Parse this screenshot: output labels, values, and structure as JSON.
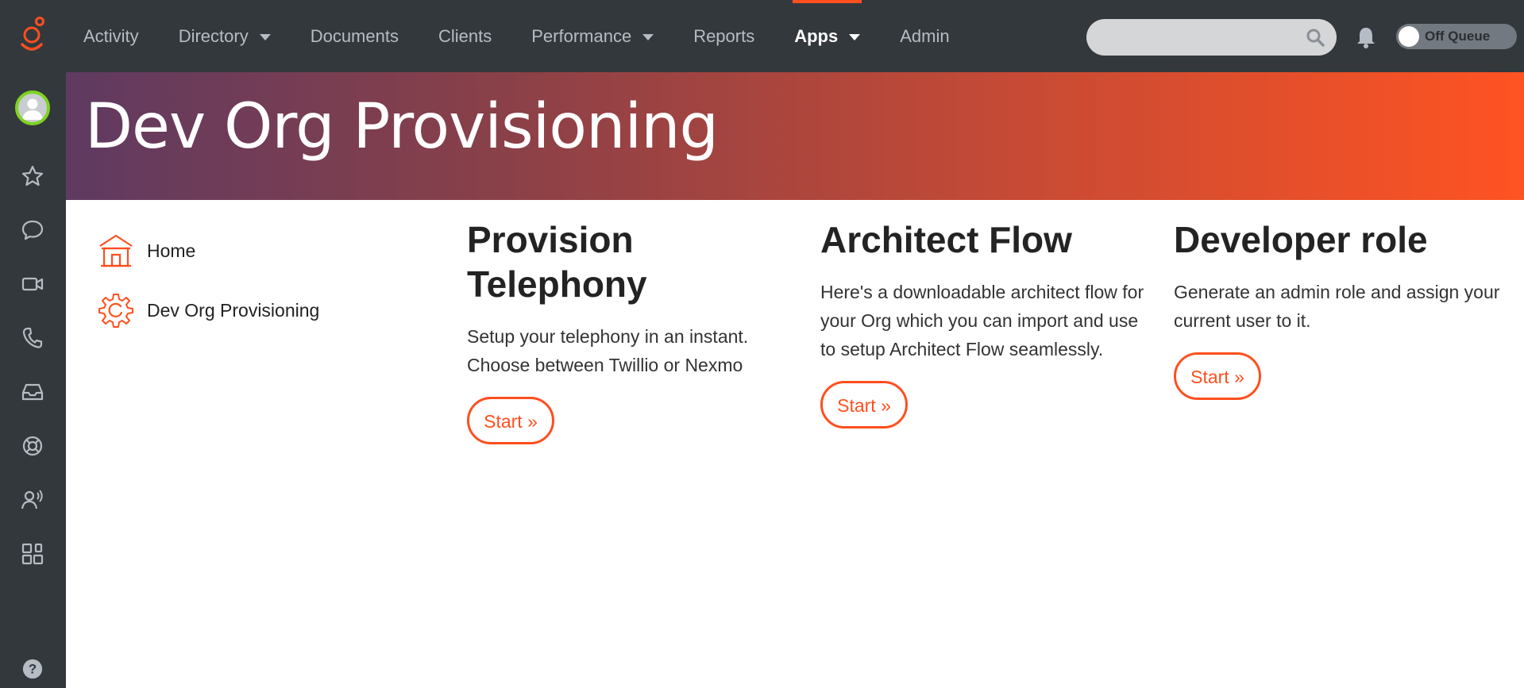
{
  "nav": {
    "items": [
      {
        "label": "Activity",
        "dropdown": false,
        "active": false
      },
      {
        "label": "Directory",
        "dropdown": true,
        "active": false
      },
      {
        "label": "Documents",
        "dropdown": false,
        "active": false
      },
      {
        "label": "Clients",
        "dropdown": false,
        "active": false
      },
      {
        "label": "Performance",
        "dropdown": true,
        "active": false
      },
      {
        "label": "Reports",
        "dropdown": false,
        "active": false
      },
      {
        "label": "Apps",
        "dropdown": true,
        "active": true
      },
      {
        "label": "Admin",
        "dropdown": false,
        "active": false
      }
    ],
    "search_placeholder": "",
    "queue_status": "Off Queue"
  },
  "rail": {
    "icons": [
      "favorites-icon",
      "chat-icon",
      "video-icon",
      "phone-icon",
      "inbox-icon",
      "support-icon",
      "voice-user-icon",
      "apps-grid-icon",
      "help-icon"
    ]
  },
  "page": {
    "title": "Dev Org Provisioning"
  },
  "sidenav": {
    "items": [
      {
        "label": "Home",
        "icon": "home-icon"
      },
      {
        "label": "Dev Org Provisioning",
        "icon": "gear-icon"
      }
    ]
  },
  "cards": [
    {
      "title": "Provision Telephony",
      "description": "Setup your telephony in an instant. Choose between Twillio or Nexmo",
      "button": "Start »"
    },
    {
      "title": "Architect Flow",
      "description": "Here's a downloadable architect flow for your Org which you can import and use to setup Architect Flow seamlessly.",
      "button": "Start »"
    },
    {
      "title": "Developer role",
      "description": "Generate an admin role and assign your current user to it.",
      "button": "Start »"
    }
  ],
  "colors": {
    "accent": "#ff4f1f",
    "nav_bg": "#33383d",
    "presence": "#7ed321"
  }
}
